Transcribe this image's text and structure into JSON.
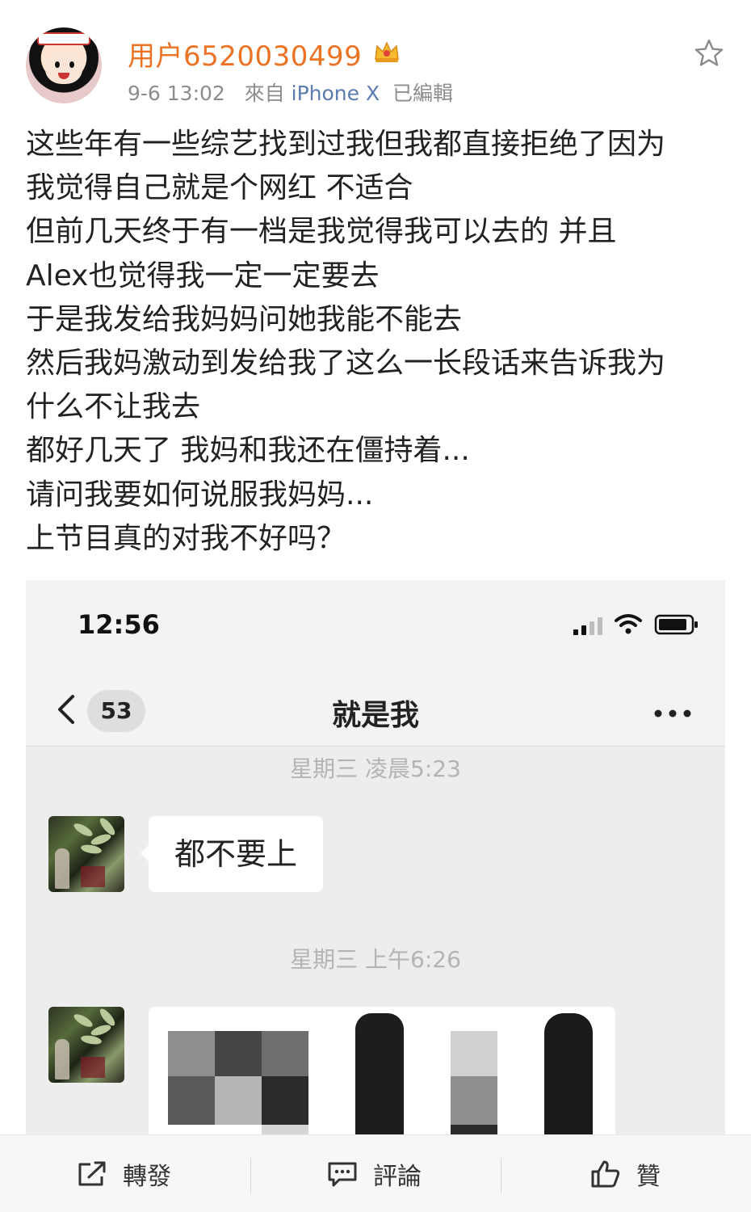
{
  "author": {
    "name": "用户6520030499",
    "time": "9-6 13:02",
    "from_prefix": "來自",
    "device": "iPhone X",
    "edited": "已編輯"
  },
  "post_lines": [
    "这些年有一些综艺找到过我但我都直接拒绝了因为",
    "我觉得自己就是个网红 不适合",
    "但前几天终于有一档是我觉得我可以去的 并且",
    "Alex也觉得我一定一定要去",
    "于是我发给我妈妈问她我能不能去",
    "然后我妈激动到发给我了这么一长段话来告诉我为",
    "什么不让我去",
    "都好几天了 我妈和我还在僵持着...",
    "请问我要如何说服我妈妈...",
    "上节目真的对我不好吗？"
  ],
  "screenshot": {
    "clock": "12:56",
    "unread_count": "53",
    "chat_title": "就是我",
    "time_label_1": "星期三 凌晨5:23",
    "message_1": "都不要上",
    "time_label_2": "星期三 上午6:26"
  },
  "actions": {
    "repost": "轉發",
    "comment": "評論",
    "like": "贊"
  },
  "colors": {
    "username": "#eb7323",
    "device_link": "#5a7cae",
    "meta_gray": "#8d8d8d"
  }
}
